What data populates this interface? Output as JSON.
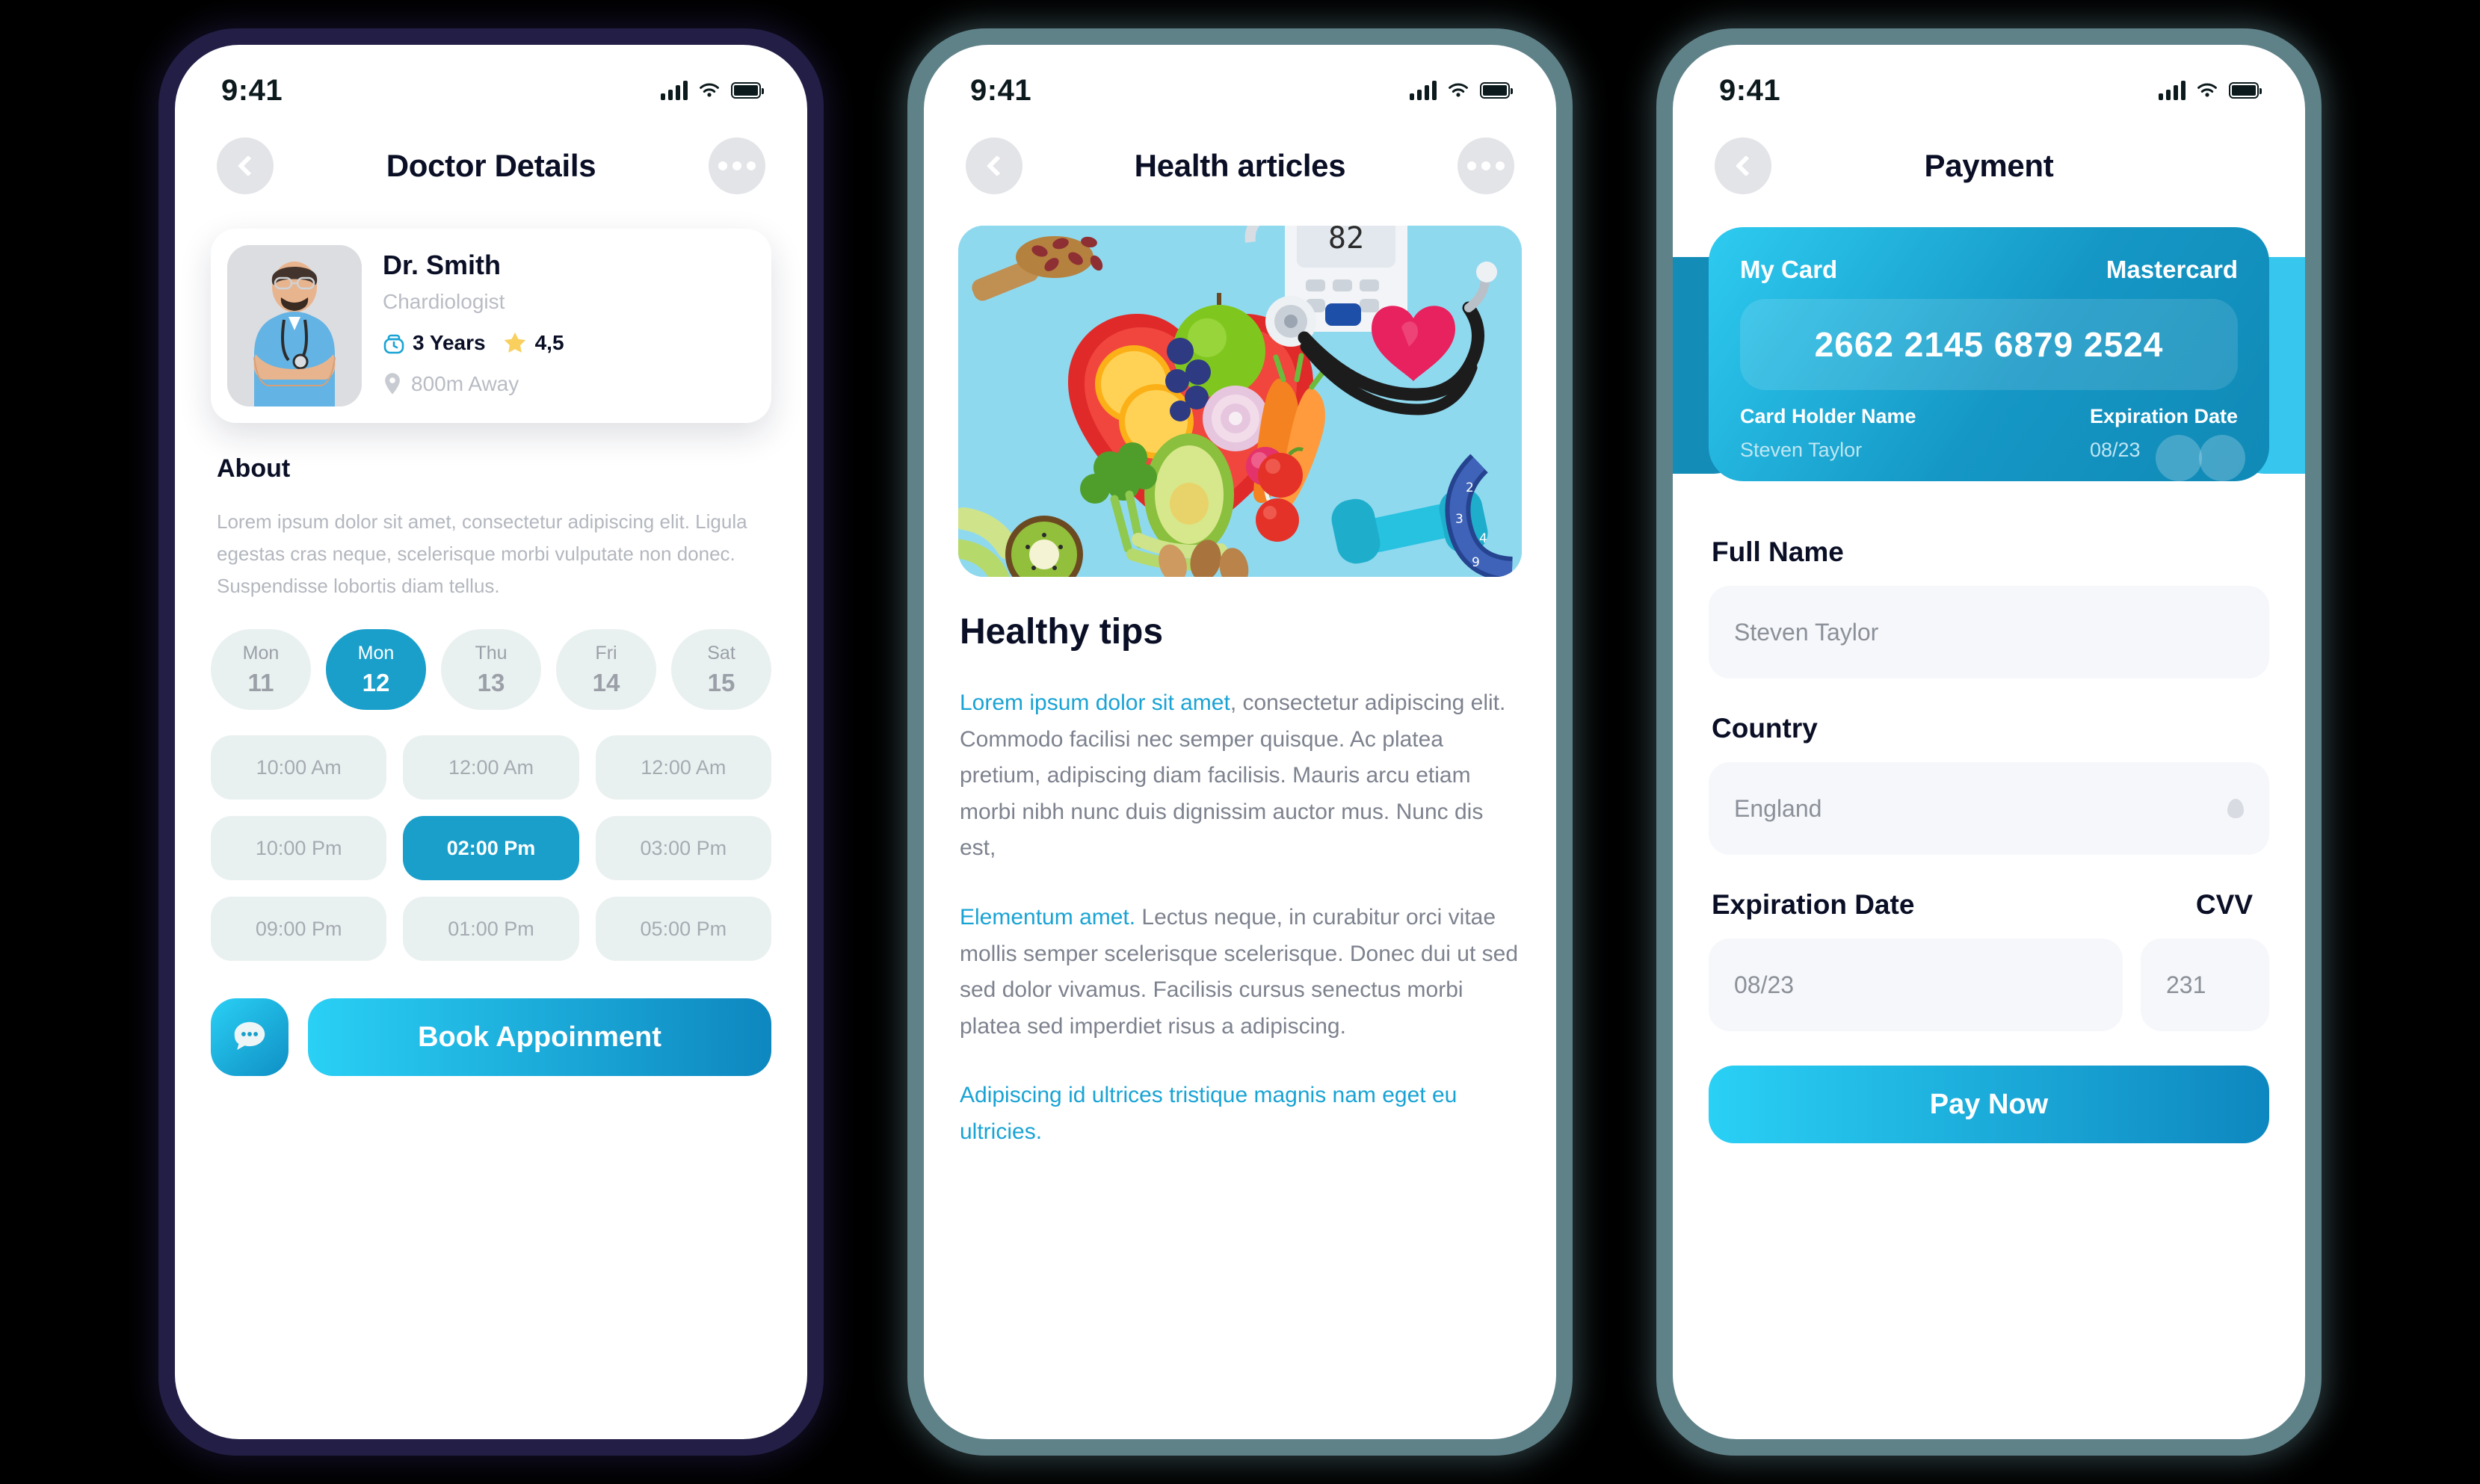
{
  "status_bar": {
    "time": "9:41",
    "signal_icon": "cellular-bars-icon",
    "wifi_icon": "wifi-icon",
    "battery_icon": "battery-full-icon"
  },
  "screen_doctor": {
    "nav": {
      "back_icon": "chevron-left-icon",
      "title": "Doctor Details",
      "more_icon": "more-horizontal-icon"
    },
    "doctor": {
      "avatar": "doctor-portrait",
      "name": "Dr. Smith",
      "specialty": "Chardiologist",
      "experience_icon": "bag-icon",
      "experience": "3 Years",
      "rating_icon": "star-icon",
      "rating": "4,5",
      "location_icon": "map-pin-icon",
      "distance": "800m Away"
    },
    "about_title": "About",
    "about_text": "Lorem ipsum dolor sit amet, consectetur adipiscing elit. Ligula egestas cras neque, scelerisque morbi vulputate non donec. Suspendisse lobortis diam tellus.",
    "dates": [
      {
        "dow": "Mon",
        "day": "11",
        "selected": false
      },
      {
        "dow": "Mon",
        "day": "12",
        "selected": true
      },
      {
        "dow": "Thu",
        "day": "13",
        "selected": false
      },
      {
        "dow": "Fri",
        "day": "14",
        "selected": false
      },
      {
        "dow": "Sat",
        "day": "15",
        "selected": false
      }
    ],
    "times": [
      {
        "label": "10:00 Am",
        "selected": false
      },
      {
        "label": "12:00 Am",
        "selected": false
      },
      {
        "label": "12:00 Am",
        "selected": false
      },
      {
        "label": "10:00 Pm",
        "selected": false
      },
      {
        "label": "02:00 Pm",
        "selected": true
      },
      {
        "label": "03:00 Pm",
        "selected": false
      },
      {
        "label": "09:00 Pm",
        "selected": false
      },
      {
        "label": "01:00 Pm",
        "selected": false
      },
      {
        "label": "05:00 Pm",
        "selected": false
      }
    ],
    "chat_icon": "chat-bubble-icon",
    "book_label": "Book Appoinment"
  },
  "screen_article": {
    "nav": {
      "back_icon": "chevron-left-icon",
      "title": "Health articles",
      "more_icon": "more-horizontal-icon"
    },
    "hero_image": "healthy-food-and-medical-equipment-photo",
    "heading": "Healthy tips",
    "p1_highlight": "Lorem ipsum dolor sit amet",
    "p1_rest": ", consectetur adipiscing elit. Commodo facilisi nec semper quisque. Ac platea pretium, adipiscing diam facilisis. Mauris arcu etiam morbi nibh nunc duis dignissim auctor mus. Nunc dis est,",
    "p2_highlight": "Elementum amet.",
    "p2_rest": " Lectus neque, in curabitur orci vitae mollis semper scelerisque scelerisque. Donec dui ut sed sed dolor vivamus. Facilisis cursus senectus morbi platea sed imperdiet risus a adipiscing.",
    "p3": "Adipiscing id ultrices tristique magnis nam eget eu ultricies."
  },
  "screen_payment": {
    "nav": {
      "back_icon": "chevron-left-icon",
      "title": "Payment"
    },
    "card": {
      "title": "My Card",
      "brand": "Mastercard",
      "number": "2662 2145 6879 2524",
      "holder_label": "Card Holder Name",
      "holder_value": "Steven Taylor",
      "expiry_label": "Expiration Date",
      "expiry_value": "08/23",
      "brand_icon": "mastercard-circles-icon"
    },
    "full_name_label": "Full Name",
    "full_name_value": "Steven Taylor",
    "country_label": "Country",
    "country_value": "England",
    "country_caret_icon": "chevron-down-icon",
    "expiry_label": "Expiration Date",
    "expiry_value": "08/23",
    "cvv_label": "CVV",
    "cvv_value": "231",
    "pay_label": "Pay Now"
  },
  "colors": {
    "accent": "#1a9fcb",
    "accent_light": "#2ad0f5",
    "dark": "#0a0f26",
    "pill_bg": "#e9f1f0",
    "frame_navy": "#221e46",
    "frame_teal": "#5f8289"
  }
}
